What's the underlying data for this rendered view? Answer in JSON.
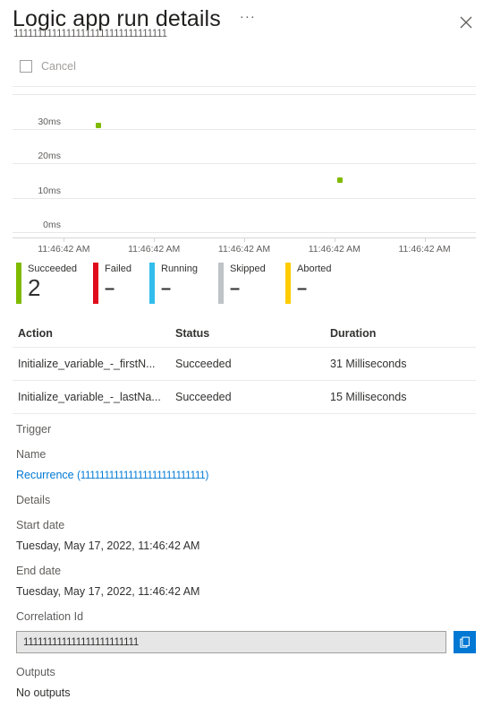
{
  "header": {
    "title": "Logic app run details",
    "subtitle": "11111111111111111111111111111111",
    "more_label": "···",
    "close_icon": "close-icon"
  },
  "command_bar": {
    "cancel_label": "Cancel",
    "cancel_icon": "stop-square-icon",
    "cancel_disabled": true
  },
  "chart_data": {
    "type": "scatter",
    "title": "",
    "xlabel": "",
    "ylabel": "",
    "ylim": [
      0,
      40
    ],
    "yticks": [
      0,
      10,
      20,
      30
    ],
    "ytick_labels": [
      "0ms",
      "10ms",
      "20ms",
      "30ms"
    ],
    "xtick_labels": [
      "11:46:42 AM",
      "11:46:42 AM",
      "11:46:42 AM",
      "11:46:42 AM",
      "11:46:42 AM"
    ],
    "grid": true,
    "legend": "none",
    "series": [
      {
        "name": "Duration",
        "color": "#7fba00",
        "points": [
          {
            "x_index": 0.38,
            "y": 31,
            "label": "31 Milliseconds"
          },
          {
            "x_index": 3.06,
            "y": 15,
            "label": "15 Milliseconds"
          }
        ]
      }
    ]
  },
  "status_tiles": [
    {
      "label": "Succeeded",
      "value": "2",
      "color": "#7fba00",
      "is_dash": false
    },
    {
      "label": "Failed",
      "value": "–",
      "color": "#e00b1c",
      "is_dash": true
    },
    {
      "label": "Running",
      "value": "–",
      "color": "#32bdec",
      "is_dash": true
    },
    {
      "label": "Skipped",
      "value": "–",
      "color": "#bdc3c7",
      "is_dash": true
    },
    {
      "label": "Aborted",
      "value": "–",
      "color": "#ffcc00",
      "is_dash": true
    }
  ],
  "table": {
    "columns": [
      "Action",
      "Status",
      "Duration"
    ],
    "rows": [
      {
        "action": "Initialize_variable_-_firstN...",
        "status": "Succeeded",
        "duration": "31 Milliseconds"
      },
      {
        "action": "Initialize_variable_-_lastNa...",
        "status": "Succeeded",
        "duration": "15 Milliseconds"
      }
    ]
  },
  "details": {
    "trigger_heading": "Trigger",
    "name_label": "Name",
    "trigger_name": "Recurrence",
    "trigger_name_suffix": "(11111111111111111111111111)",
    "details_label": "Details",
    "start_date_label": "Start date",
    "start_date_value": "Tuesday, May 17, 2022, 11:46:42 AM",
    "end_date_label": "End date",
    "end_date_value": "Tuesday, May 17, 2022, 11:46:42 AM",
    "correlation_label": "Correlation Id",
    "correlation_value": "111111111111111111111111",
    "correlation_placeholder": "",
    "copy_icon": "copy-icon",
    "outputs_label": "Outputs",
    "outputs_value": "No outputs"
  }
}
